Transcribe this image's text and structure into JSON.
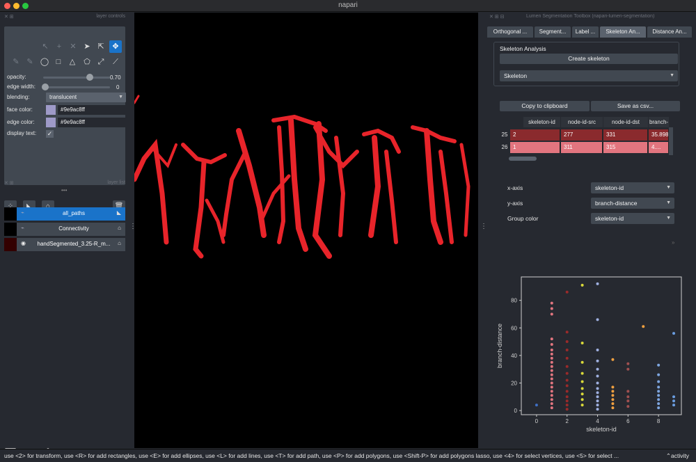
{
  "window": {
    "title": "napari"
  },
  "left_dock": {
    "controls_title": "layer controls",
    "list_title": "layer list",
    "opacity_label": "opacity:",
    "opacity_value": "0.70",
    "opacity_fraction": 0.7,
    "edge_width_label": "edge width:",
    "edge_width_value": "0",
    "blending_label": "blending:",
    "blending_value": "translucent",
    "face_color_label": "face color:",
    "face_color_value": "#9e9ac8ff",
    "edge_color_label": "edge color:",
    "edge_color_value": "#9e9ac8ff",
    "display_text_label": "display text:",
    "layers": [
      {
        "name": "all_paths",
        "selected": true
      },
      {
        "name": "Connectivity",
        "selected": false
      },
      {
        "name": "handSegmented_3.25-R_m...",
        "selected": false
      }
    ]
  },
  "right_dock": {
    "title": "Lumen Segmentation Toolbox (napari-lumen-segmentation)",
    "tabs": [
      "Orthogonal ...",
      "Segment...",
      "Label ...",
      "Skeleton An...",
      "Distance An..."
    ],
    "selected_tab": 3,
    "group_title": "Skeleton Analysis",
    "create_button": "Create skeleton",
    "skeleton_combo": "Skeleton",
    "copy_button": "Copy to clipboard",
    "save_button": "Save as csv...",
    "table": {
      "columns": [
        "skeleton-id",
        "node-id-src",
        "node-id-dst",
        "branch-"
      ],
      "rows": [
        {
          "index": "25",
          "cells": [
            "2",
            "277",
            "331",
            "35.898"
          ]
        },
        {
          "index": "26",
          "cells": [
            "1",
            "311",
            "315",
            "4...."
          ]
        }
      ]
    },
    "x_axis_label": "x-axis",
    "x_axis_value": "skeleton-id",
    "y_axis_label": "y-axis",
    "y_axis_value": "branch-distance",
    "group_label": "Group color",
    "group_value": "skeleton-id"
  },
  "chart_data": {
    "type": "scatter",
    "xlabel": "skeleton-id",
    "ylabel": "branch-distance",
    "xlim": [
      -1,
      9.5
    ],
    "ylim": [
      -3,
      97
    ],
    "xticks": [
      "0",
      "2",
      "4",
      "6",
      "8"
    ],
    "yticks": [
      "0",
      "20",
      "40",
      "60",
      "80"
    ],
    "series": [
      {
        "color": "#3f6fc4",
        "values": [
          [
            0,
            4
          ]
        ]
      },
      {
        "color": "#e2757f",
        "values": [
          [
            1,
            2
          ],
          [
            1,
            5
          ],
          [
            1,
            8
          ],
          [
            1,
            11
          ],
          [
            1,
            14
          ],
          [
            1,
            17
          ],
          [
            1,
            20
          ],
          [
            1,
            23
          ],
          [
            1,
            26
          ],
          [
            1,
            29
          ],
          [
            1,
            32
          ],
          [
            1,
            35
          ],
          [
            1,
            38
          ],
          [
            1,
            41
          ],
          [
            1,
            44
          ],
          [
            1,
            48
          ],
          [
            1,
            52
          ],
          [
            1,
            70
          ],
          [
            1,
            74
          ],
          [
            1,
            78
          ]
        ]
      },
      {
        "color": "#9a2a2a",
        "values": [
          [
            2,
            1
          ],
          [
            2,
            4
          ],
          [
            2,
            7
          ],
          [
            2,
            10
          ],
          [
            2,
            14
          ],
          [
            2,
            18
          ],
          [
            2,
            22
          ],
          [
            2,
            27
          ],
          [
            2,
            32
          ],
          [
            2,
            38
          ],
          [
            2,
            44
          ],
          [
            2,
            50
          ],
          [
            2,
            57
          ],
          [
            2,
            86
          ]
        ]
      },
      {
        "color": "#d9d93a",
        "values": [
          [
            3,
            4
          ],
          [
            3,
            8
          ],
          [
            3,
            12
          ],
          [
            3,
            16
          ],
          [
            3,
            21
          ],
          [
            3,
            27
          ],
          [
            3,
            35
          ],
          [
            3,
            49
          ],
          [
            3,
            91
          ]
        ]
      },
      {
        "color": "#9fb0e0",
        "values": [
          [
            4,
            1
          ],
          [
            4,
            4
          ],
          [
            4,
            7
          ],
          [
            4,
            10
          ],
          [
            4,
            13
          ],
          [
            4,
            16
          ],
          [
            4,
            20
          ],
          [
            4,
            25
          ],
          [
            4,
            30
          ],
          [
            4,
            36
          ],
          [
            4,
            44
          ],
          [
            4,
            66
          ],
          [
            4,
            92
          ]
        ]
      },
      {
        "color": "#f0a040",
        "values": [
          [
            5,
            2
          ],
          [
            5,
            5
          ],
          [
            5,
            8
          ],
          [
            5,
            11
          ],
          [
            5,
            14
          ],
          [
            5,
            17
          ],
          [
            5,
            37
          ]
        ]
      },
      {
        "color": "#a05050",
        "values": [
          [
            6,
            3
          ],
          [
            6,
            7
          ],
          [
            6,
            10
          ],
          [
            6,
            14
          ],
          [
            6,
            30
          ],
          [
            6,
            34
          ]
        ]
      },
      {
        "color": "#f0a040",
        "values": [
          [
            7,
            61
          ]
        ]
      },
      {
        "color": "#7ea6e0",
        "values": [
          [
            8,
            2
          ],
          [
            8,
            5
          ],
          [
            8,
            8
          ],
          [
            8,
            11
          ],
          [
            8,
            14
          ],
          [
            8,
            17
          ],
          [
            8,
            21
          ],
          [
            8,
            26
          ],
          [
            8,
            33
          ]
        ]
      },
      {
        "color": "#6a9de0",
        "values": [
          [
            9,
            4
          ],
          [
            9,
            7
          ],
          [
            9,
            10
          ],
          [
            9,
            56
          ]
        ]
      }
    ]
  },
  "status": {
    "message": "use <2> for transform, use <R> for add rectangles, use <E> for add ellipses, use <L> for add lines, use <T> for add path, use <P> for add polygons, use <Shift-P> for add polygons lasso, use <4> for select vertices, use <5> for select ...",
    "activity": "activity"
  },
  "colors": {
    "accent": "#1a73c9",
    "panel": "#414851",
    "bg": "#262930",
    "segmentation": "#e8242a"
  }
}
